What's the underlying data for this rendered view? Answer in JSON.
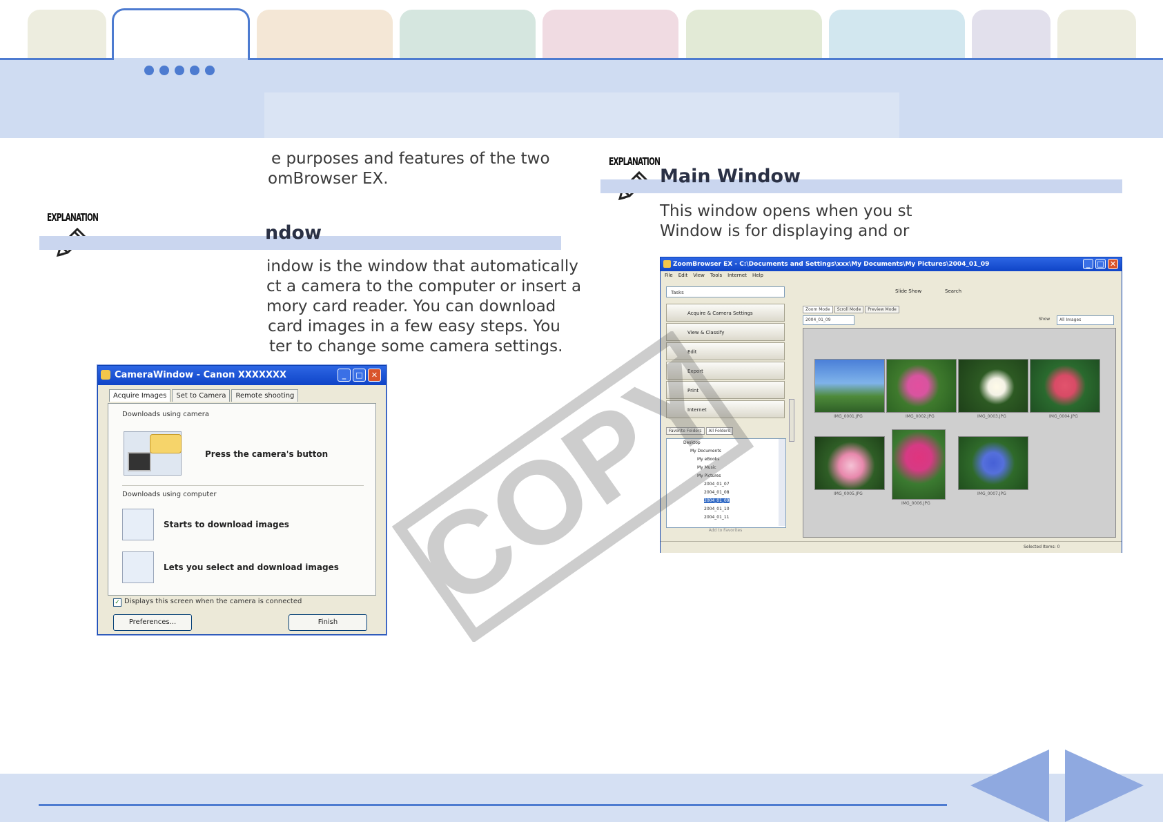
{
  "colors": {
    "accent": "#4d7bd0",
    "band": "#cfdcf2",
    "section_bar": "#cad6ef"
  },
  "intro_lines": [
    "e purposes and features of the two",
    "omBrowser EX."
  ],
  "left_section": {
    "badge": "EXPLANATION",
    "title": "ndow",
    "body_lines": [
      "indow is the window that automatically",
      "ct a camera to the computer or insert a",
      "mory card reader. You can download",
      "card images in a few easy steps. You",
      "ter to change some camera settings."
    ]
  },
  "right_section": {
    "badge": "EXPLANATION",
    "title": "Main Window",
    "body_lines": [
      "This window opens when you st",
      "Window is for displaying and or"
    ]
  },
  "camera_window": {
    "title": "CameraWindow - Canon XXXXXXX",
    "tabs": [
      "Acquire Images",
      "Set to Camera",
      "Remote shooting"
    ],
    "camera_group_label": "Downloads using camera",
    "camera_button_text": "Press the camera's button",
    "computer_group_label": "Downloads using computer",
    "option1": "Starts to download images",
    "option2": "Lets you select and download images",
    "checkbox_label": "Displays this screen when the camera is connected",
    "preferences": "Preferences...",
    "finish": "Finish"
  },
  "main_window": {
    "title": "ZoomBrowser EX  -  C:\\Documents and Settings\\xxx\\My Documents\\My Pictures\\2004_01_09",
    "menu": [
      "File",
      "Edit",
      "View",
      "Tools",
      "Internet",
      "Help"
    ],
    "tasks_label": "Tasks",
    "toolbar": [
      "Slide Show",
      "Search"
    ],
    "side_buttons": [
      "Acquire & Camera Settings",
      "View & Classify",
      "Edit",
      "Export",
      "Print",
      "Internet"
    ],
    "tree_tabs": [
      "Favorite Folders",
      "All Folders"
    ],
    "tree_items": [
      "Desktop",
      "My Documents",
      "My eBooks",
      "My Music",
      "My Pictures",
      "2004_01_07",
      "2004_01_08",
      "2004_01_09",
      "2004_01_10",
      "2004_01_11"
    ],
    "register_label": "Add to Favorites",
    "view_tabs": [
      "Zoom Mode",
      "Scroll Mode",
      "Preview Mode"
    ],
    "folder_field": "2004_01_09",
    "show_label": "Show",
    "show_value": "All Images",
    "thumb_captions": [
      "IMG_0001.JPG",
      "IMG_0002.JPG",
      "IMG_0003.JPG",
      "IMG_0004.JPG",
      "IMG_0005.JPG",
      "IMG_0006.JPG",
      "IMG_0007.JPG"
    ],
    "status": "Selected Items: 0"
  },
  "watermark": "COPY"
}
